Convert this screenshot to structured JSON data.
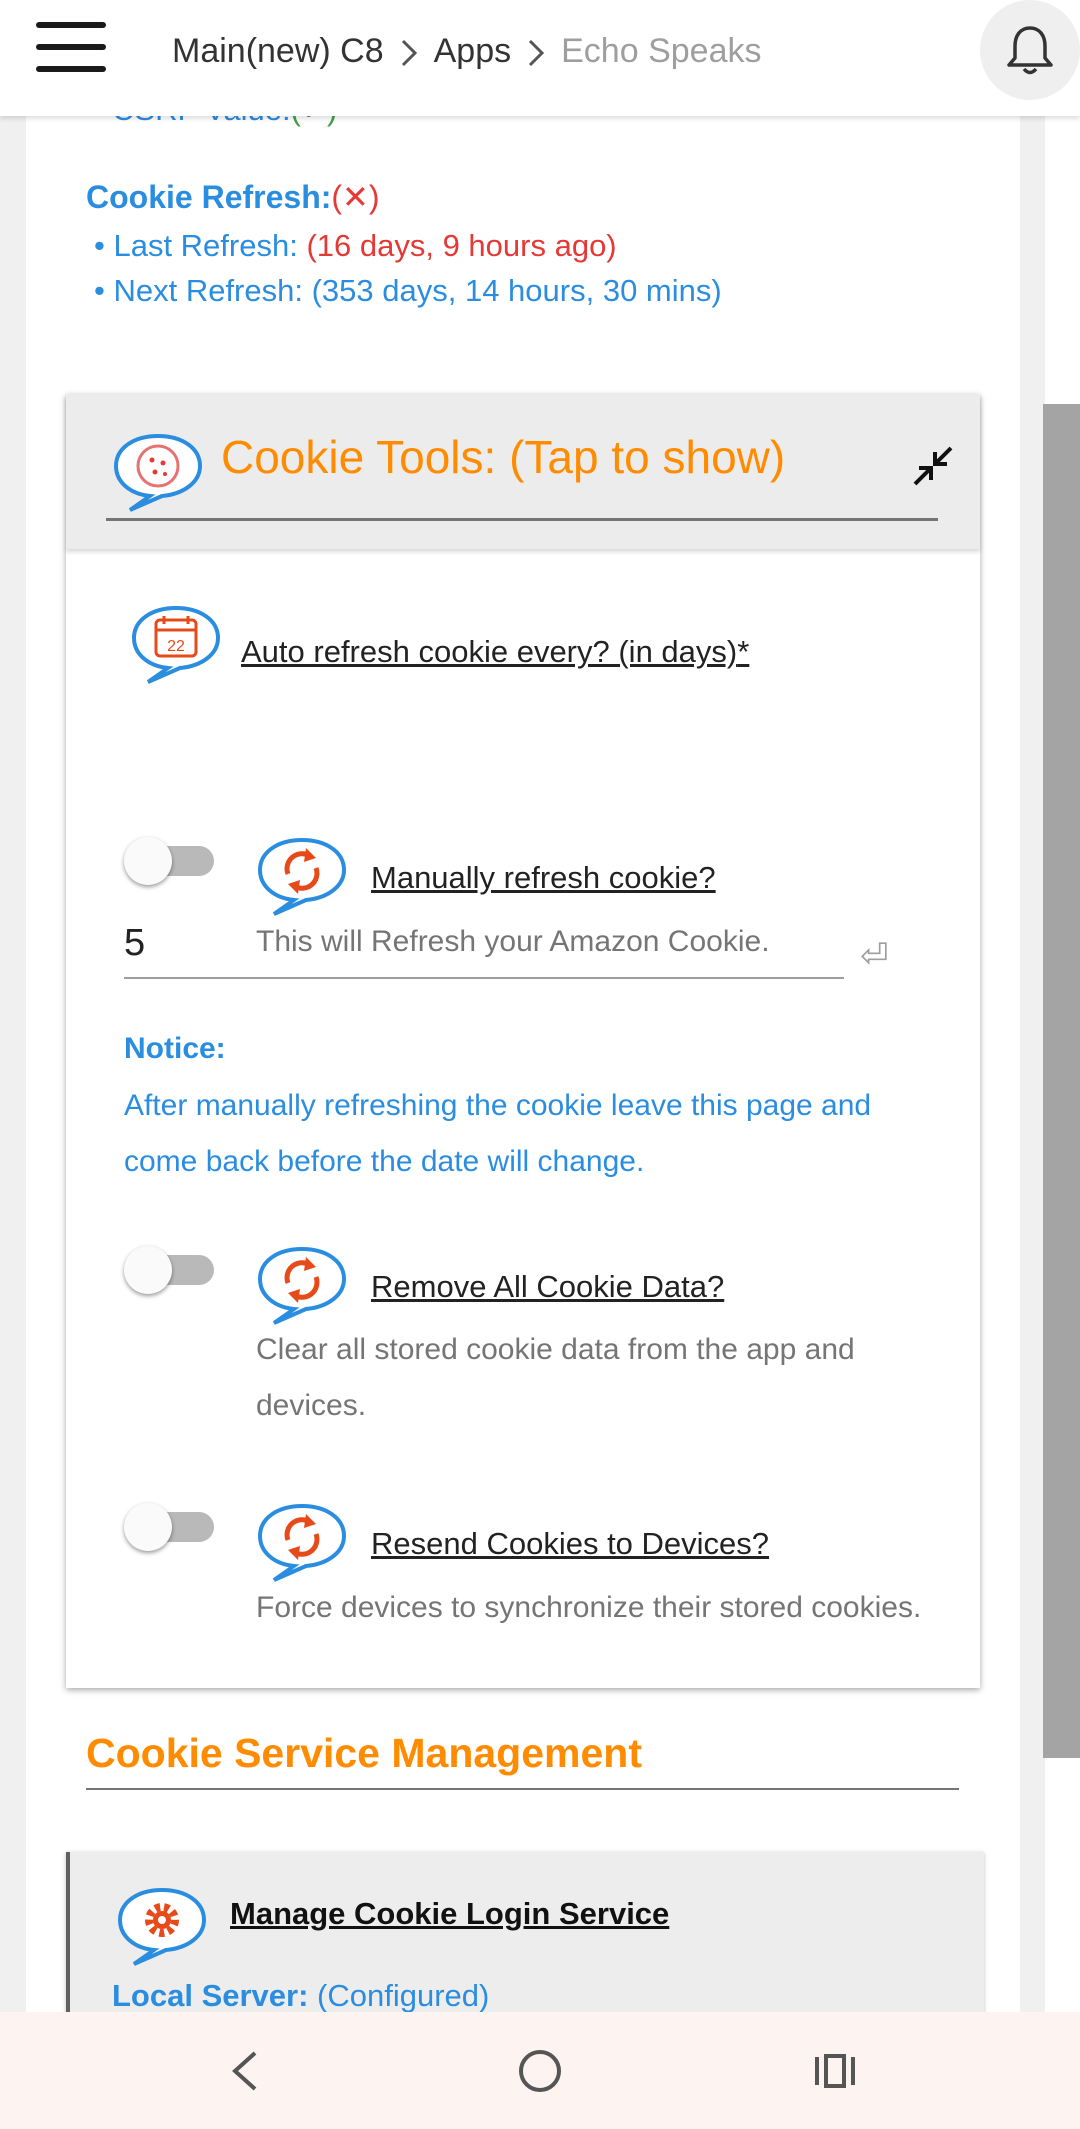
{
  "header": {
    "breadcrumb": [
      "Main(new) C8",
      "Apps",
      "Echo Speaks"
    ],
    "menu_icon": "hamburger-icon",
    "notification_icon": "bell-icon"
  },
  "status": {
    "partial_label": "CSRF Value:",
    "partial_value": "(✓)",
    "cookie_refresh_label": "Cookie Refresh:",
    "cookie_refresh_status": "(✕)",
    "last_refresh_label": "• Last Refresh: ",
    "last_refresh_value": "(16 days, 9 hours ago)",
    "next_refresh_label": "• Next Refresh: ",
    "next_refresh_value": "(353 days, 14 hours, 30 mins)"
  },
  "cookie_tools": {
    "title": "Cookie Tools: (Tap to show)",
    "auto_refresh": {
      "label": "Auto refresh cookie every? (in days)",
      "required_mark": "*",
      "value": "5",
      "calendar_day": "22"
    },
    "manual_refresh": {
      "label": "Manually refresh cookie?",
      "description": "This will Refresh your Amazon Cookie.",
      "enabled": false
    },
    "notice": {
      "title": "Notice:",
      "body": "After manually refreshing the cookie leave this page and come back before the date will change."
    },
    "remove_all": {
      "label": "Remove All Cookie Data?",
      "description": "Clear all stored cookie data from the app and devices.",
      "enabled": false
    },
    "resend": {
      "label": "Resend Cookies to Devices?",
      "description": "Force devices to synchronize their stored cookies.",
      "enabled": false
    }
  },
  "service": {
    "section_title": "Cookie Service Management",
    "manage_label": "Manage Cookie Login Service",
    "local_server_label": "Local Server:",
    "local_server_value": " (Configured)"
  },
  "colors": {
    "accent_orange": "#ff8c00",
    "link_blue": "#2b8de0",
    "error_red": "#e53935",
    "ok_green": "#43a047"
  }
}
